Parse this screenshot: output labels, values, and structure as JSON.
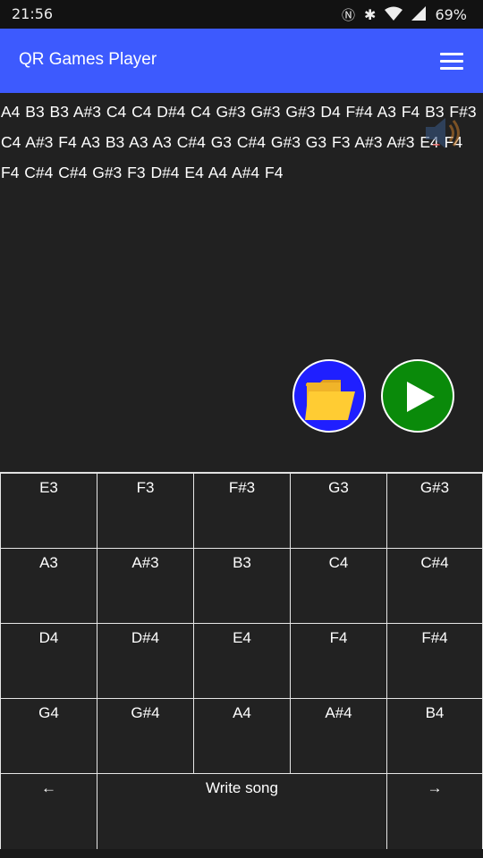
{
  "status": {
    "time": "21:56",
    "battery": "69%"
  },
  "appbar": {
    "title": "QR Games Player"
  },
  "song": {
    "text": "A4 B3 B3 A#3 C4 C4 D#4 C4 G#3 G#3 G#3 D4 F#4 A3 F4 B3 F#3 C4 A#3 F4 A3 B3 A3 A3 C#4 G3 C#4 G#3 G3 F3 A#3 A#3 E4 F4 F4 C#4 C#4 G#3 F3 D#4 E4 A4 A#4 F4"
  },
  "keys": [
    "E3",
    "F3",
    "F#3",
    "G3",
    "G#3",
    "A3",
    "A#3",
    "B3",
    "C4",
    "C#4",
    "D4",
    "D#4",
    "E4",
    "F4",
    "F#4",
    "G4",
    "G#4",
    "A4",
    "A#4",
    "B4"
  ],
  "controls": {
    "left": "←",
    "write": "Write song",
    "right": "→"
  },
  "colors": {
    "appbar": "#3d5afe",
    "open_button": "#1f1fff",
    "play_button": "#0a8a0a",
    "background": "#212121"
  }
}
